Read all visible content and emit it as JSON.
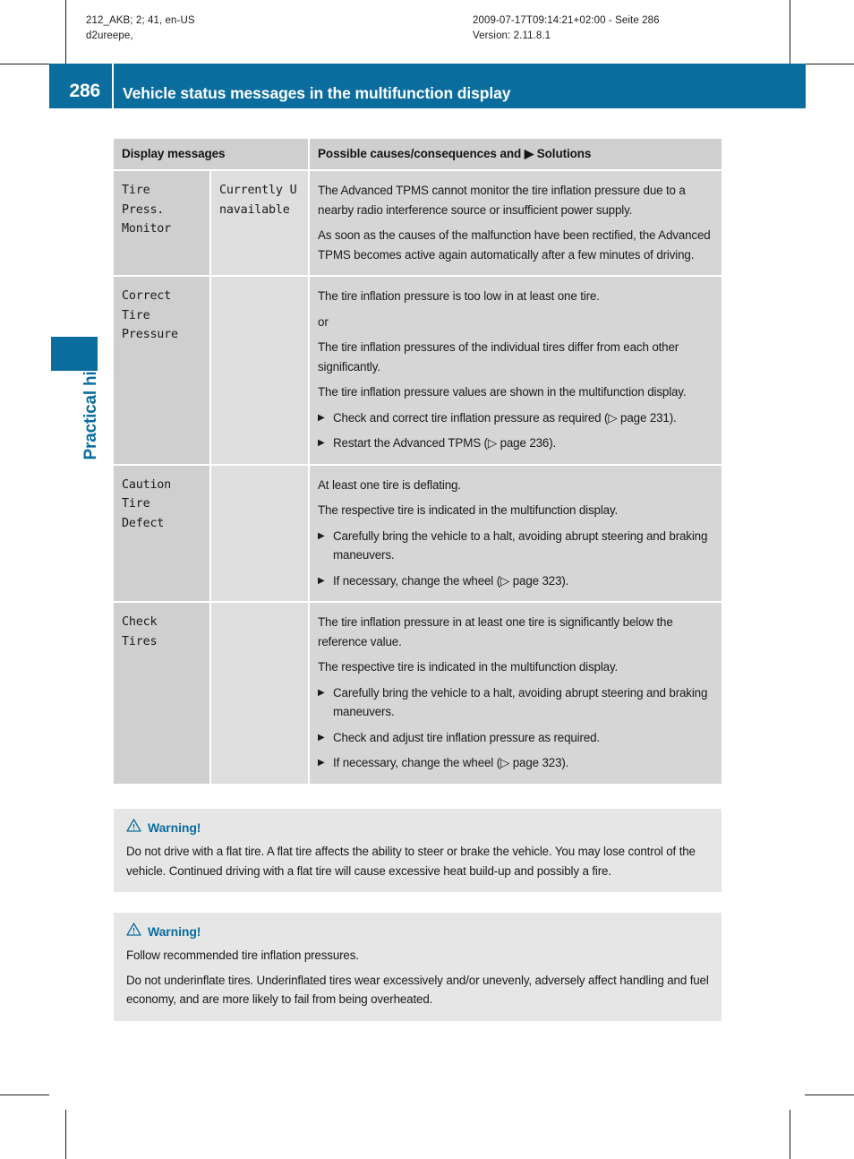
{
  "meta": {
    "left_block": "212_AKB; 2; 41, en-US\nd2ureepe,",
    "right_block": "2009-07-17T09:14:21+02:00 - Seite 286\nVersion: 2.11.8.1"
  },
  "header": {
    "page_number": "286",
    "title": "Vehicle status messages in the multifunction display",
    "accent_color": "#0a6d9e"
  },
  "chapter": {
    "label": "Practical hints"
  },
  "table": {
    "columns": [
      "Display messages",
      "Possible causes/consequences and ▶ Solutions"
    ],
    "rows": [
      {
        "message": "Tire\nPress.\nMonitor",
        "message_2": "Currently Unavailable",
        "paragraphs": [
          "The Advanced TPMS cannot monitor the tire inflation pressure due to a nearby radio interference source or insufficient power supply.",
          "As soon as the causes of the malfunction have been rectified, the Advanced TPMS becomes active again automatically after a few minutes of driving."
        ],
        "solutions": []
      },
      {
        "message": "Correct\nTire\nPressure",
        "message_2": "",
        "paragraphs": [
          "The tire inflation pressure is too low in at least one tire.",
          "or",
          "The tire inflation pressures of the individual tires differ from each other significantly.",
          "The tire inflation pressure values are shown in the multifunction display."
        ],
        "solutions": [
          "Check and correct tire inflation pressure as required (▷ page 231).",
          "Restart the Advanced TPMS (▷ page 236)."
        ]
      },
      {
        "message": "Caution\nTire\nDefect",
        "message_2": "",
        "paragraphs": [
          "At least one tire is deflating.",
          "The respective tire is indicated in the multifunction display."
        ],
        "solutions": [
          "Carefully bring the vehicle to a halt, avoiding abrupt steering and braking maneuvers.",
          "If necessary, change the wheel (▷ page 323)."
        ]
      },
      {
        "message": "Check\nTires",
        "message_2": "",
        "paragraphs": [
          "The tire inflation pressure in at least one tire is significantly below the reference value.",
          "The respective tire is indicated in the multifunction display."
        ],
        "solutions": [
          "Carefully bring the vehicle to a halt, avoiding abrupt steering and braking maneuvers.",
          "Check and adjust tire inflation pressure as required.",
          "If necessary, change the wheel (▷ page 323)."
        ]
      }
    ]
  },
  "warnings": [
    {
      "title": "Warning!",
      "paragraphs": [
        "Do not drive with a flat tire. A flat tire affects the ability to steer or brake the vehicle. You may lose control of the vehicle. Continued driving with a flat tire will cause excessive heat build-up and possibly a fire."
      ]
    },
    {
      "title": "Warning!",
      "paragraphs": [
        "Follow recommended tire inflation pressures.",
        "Do not underinflate tires. Underinflated tires wear excessively and/or unevenly, adversely affect handling and fuel economy, and are more likely to fail from being overheated."
      ]
    }
  ],
  "bullets": {
    "solution_marker": "▶",
    "reference_marker": "▷"
  }
}
